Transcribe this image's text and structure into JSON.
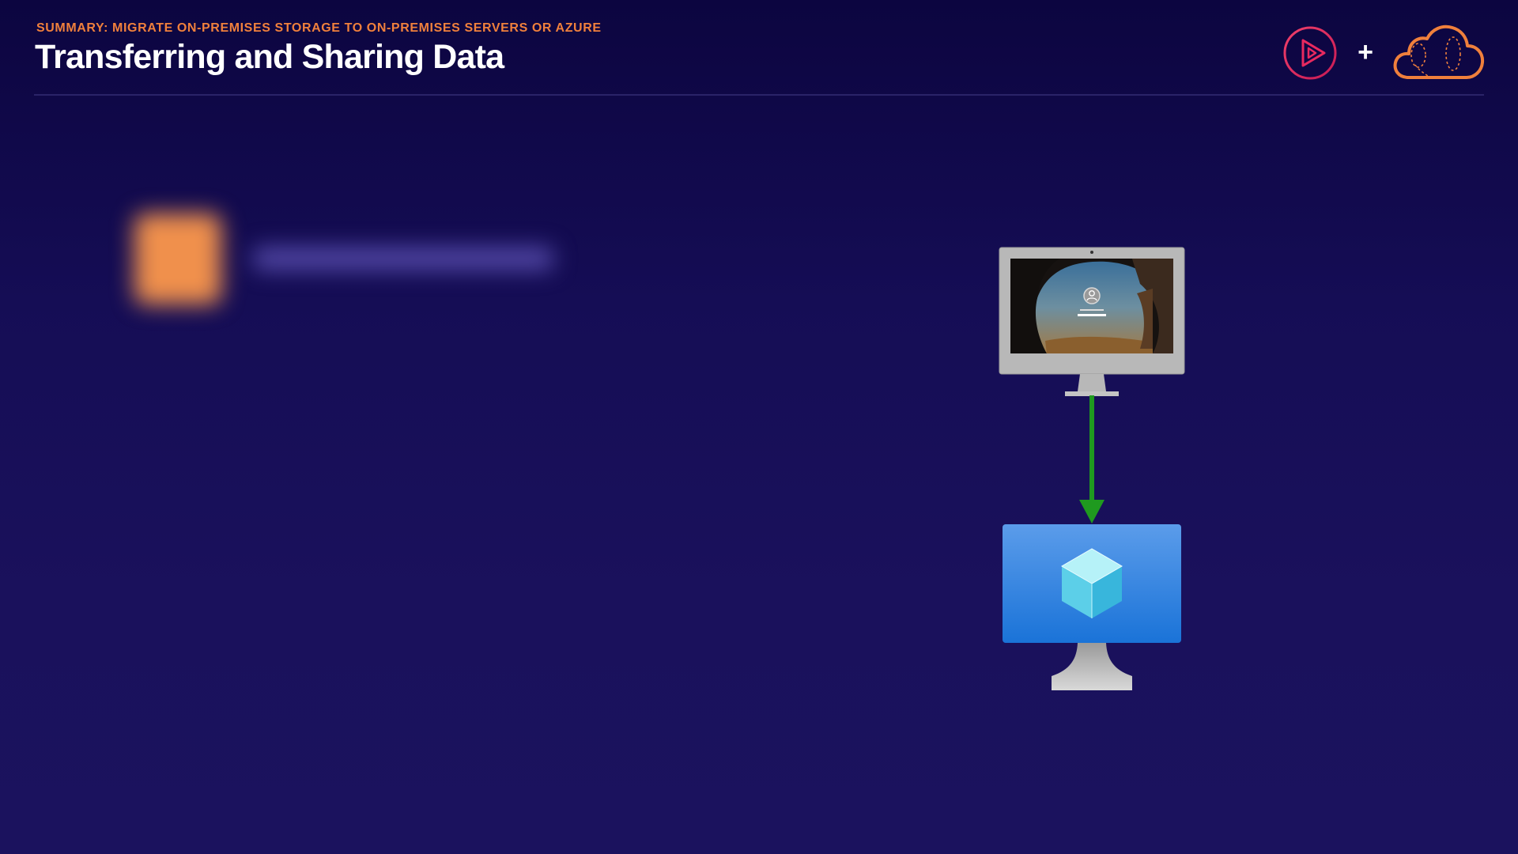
{
  "header": {
    "subtitle": "SUMMARY: MIGRATE ON-PREMISES STORAGE TO ON-PREMISES SERVERS OR AZURE",
    "title": "Transferring and Sharing Data"
  },
  "logos": {
    "play_icon": "pluralsight-play-icon",
    "plus_symbol": "+",
    "cloud_icon": "cloud-logo-icon"
  },
  "diagram": {
    "source": "on-premises-computer-icon",
    "connector": "down-arrow-icon",
    "target": "azure-virtual-machine-icon"
  },
  "colors": {
    "background_top": "#0c0540",
    "background_bottom": "#1b125e",
    "accent_orange": "#f0803c",
    "arrow_green": "#1f9a1f",
    "azure_blue": "#2b7fe0",
    "play_red": "#e8295f",
    "divider": "#2a2368"
  }
}
